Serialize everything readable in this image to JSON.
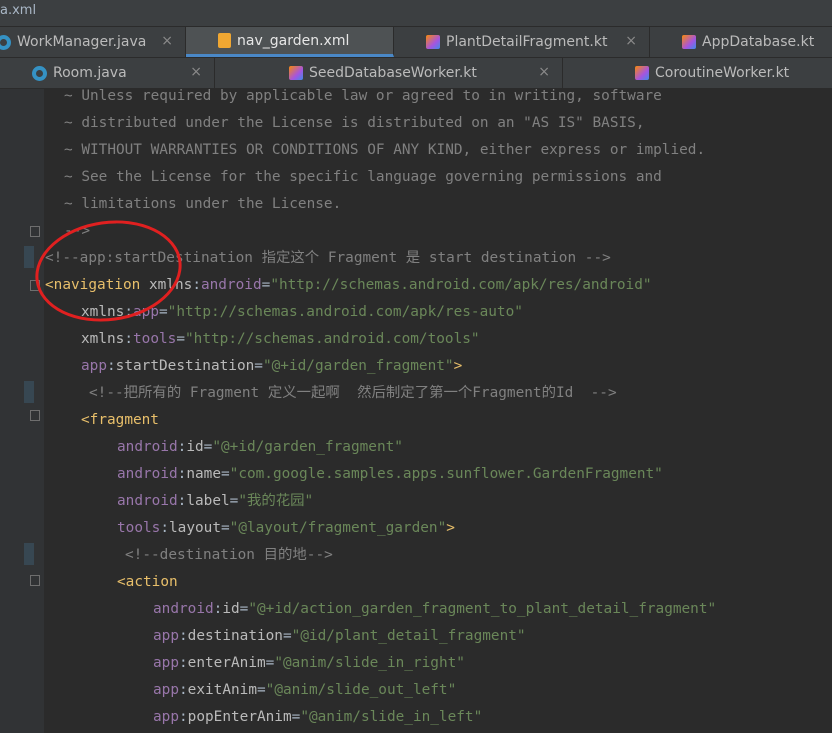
{
  "window": {
    "file_fragment": "a.xml"
  },
  "tabs_row1": [
    {
      "label": "WorkManager.java",
      "icon": "java-class-icon"
    },
    {
      "label": "nav_garden.xml",
      "icon": "xml-file-icon",
      "active": true
    },
    {
      "label": "PlantDetailFragment.kt",
      "icon": "kotlin-class-icon"
    },
    {
      "label": "AppDatabase.kt",
      "icon": "kotlin-class-icon"
    }
  ],
  "tabs_row2": [
    {
      "label": "Room.java",
      "icon": "java-class-icon"
    },
    {
      "label": "SeedDatabaseWorker.kt",
      "icon": "kotlin-class-icon"
    },
    {
      "label": "CoroutineWorker.kt",
      "icon": "kotlin-class-icon"
    }
  ],
  "close_glyph": "×",
  "colors": {
    "comment": "#808080",
    "tag": "#e8bf6a",
    "namespace": "#9876aa",
    "attribute": "#bababa",
    "value": "#6a8759",
    "annotation": "#e02020"
  },
  "code": {
    "l1": {
      "text": "~ Unless required by applicable law or agreed to in writing, software"
    },
    "l2": {
      "text": "~ distributed under the License is distributed on an \"AS IS\" BASIS,"
    },
    "l3": {
      "text": "~ WITHOUT WARRANTIES OR CONDITIONS OF ANY KIND, either express or implied."
    },
    "l4": {
      "text": "~ See the License for the specific language governing permissions and"
    },
    "l5": {
      "text": "~ limitations under the License."
    },
    "l6": {
      "text": "-->"
    },
    "l7": {
      "text": "<!--app:startDestination 指定这个 Fragment 是 start destination -->"
    },
    "l8": {
      "tag": "<navigation",
      "a1": "xmlns",
      "colon": ":",
      "n1": "android",
      "eq": "=",
      "v1": "\"http://schemas.android.com/apk/res/android\""
    },
    "l9": {
      "a1": "xmlns",
      "colon": ":",
      "n1": "app",
      "eq": "=",
      "v1": "\"http://schemas.android.com/apk/res-auto\""
    },
    "l10": {
      "a1": "xmlns",
      "colon": ":",
      "n1": "tools",
      "eq": "=",
      "v1": "\"http://schemas.android.com/tools\""
    },
    "l11": {
      "n1": "app",
      "colon": ":",
      "a1": "startDestination",
      "eq": "=",
      "v1": "\"@+id/garden_fragment\"",
      "end": ">"
    },
    "l12": {
      "text": "<!--把所有的 Fragment 定义一起啊  然后制定了第一个Fragment的Id  -->"
    },
    "l13": {
      "tag": "<fragment"
    },
    "l14": {
      "n1": "android",
      "colon": ":",
      "a1": "id",
      "eq": "=",
      "v1": "\"@+id/garden_fragment\""
    },
    "l15": {
      "n1": "android",
      "colon": ":",
      "a1": "name",
      "eq": "=",
      "v1": "\"com.google.samples.apps.sunflower.GardenFragment\""
    },
    "l16": {
      "n1": "android",
      "colon": ":",
      "a1": "label",
      "eq": "=",
      "v1": "\"我的花园\""
    },
    "l17": {
      "n1": "tools",
      "colon": ":",
      "a1": "layout",
      "eq": "=",
      "v1": "\"@layout/fragment_garden\"",
      "end": ">"
    },
    "l18": {
      "text": "<!--destination 目的地-->"
    },
    "l19": {
      "tag": "<action"
    },
    "l20": {
      "n1": "android",
      "colon": ":",
      "a1": "id",
      "eq": "=",
      "v1": "\"@+id/action_garden_fragment_to_plant_detail_fragment\""
    },
    "l21": {
      "n1": "app",
      "colon": ":",
      "a1": "destination",
      "eq": "=",
      "v1": "\"@id/plant_detail_fragment\""
    },
    "l22": {
      "n1": "app",
      "colon": ":",
      "a1": "enterAnim",
      "eq": "=",
      "v1": "\"@anim/slide_in_right\""
    },
    "l23": {
      "n1": "app",
      "colon": ":",
      "a1": "exitAnim",
      "eq": "=",
      "v1": "\"@anim/slide_out_left\""
    },
    "l24": {
      "n1": "app",
      "colon": ":",
      "a1": "popEnterAnim",
      "eq": "=",
      "v1": "\"@anim/slide_in_left\""
    }
  }
}
